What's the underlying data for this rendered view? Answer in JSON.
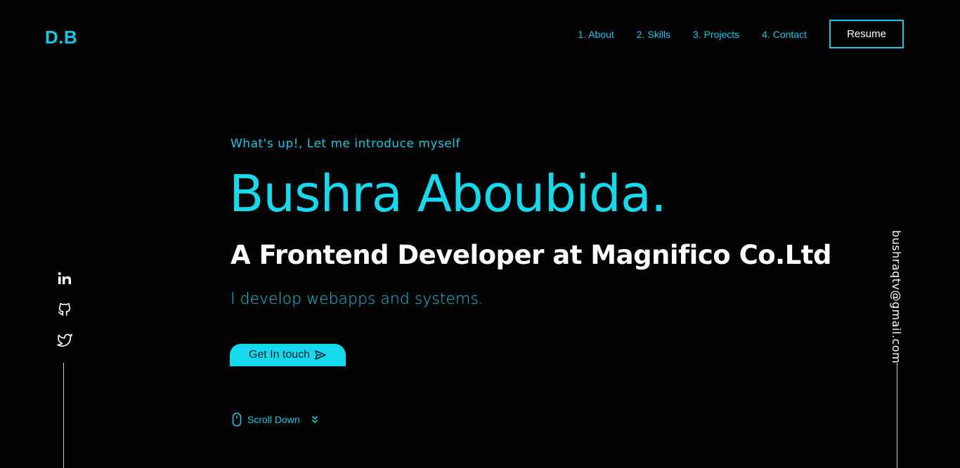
{
  "logo": "D.B",
  "nav": {
    "items": [
      "1. About",
      "2. Skills",
      "3. Projects",
      "4. Contact"
    ],
    "resume_label": "Resume"
  },
  "hero": {
    "intro": "What's up!, Let me introduce myself",
    "name": "Bushra Aboubida.",
    "role": "A Frontend Developer at Magnifico Co.Ltd",
    "tagline": "I develop webapps and systems.",
    "cta_label": "Get In touch",
    "scroll_label": "Scroll Down"
  },
  "social": {
    "icons": [
      "linkedin-icon",
      "github-icon",
      "twitter-icon"
    ]
  },
  "email": "bushraqtv@gmail.com",
  "colors": {
    "accent": "#16c6e6",
    "background": "#030303"
  }
}
